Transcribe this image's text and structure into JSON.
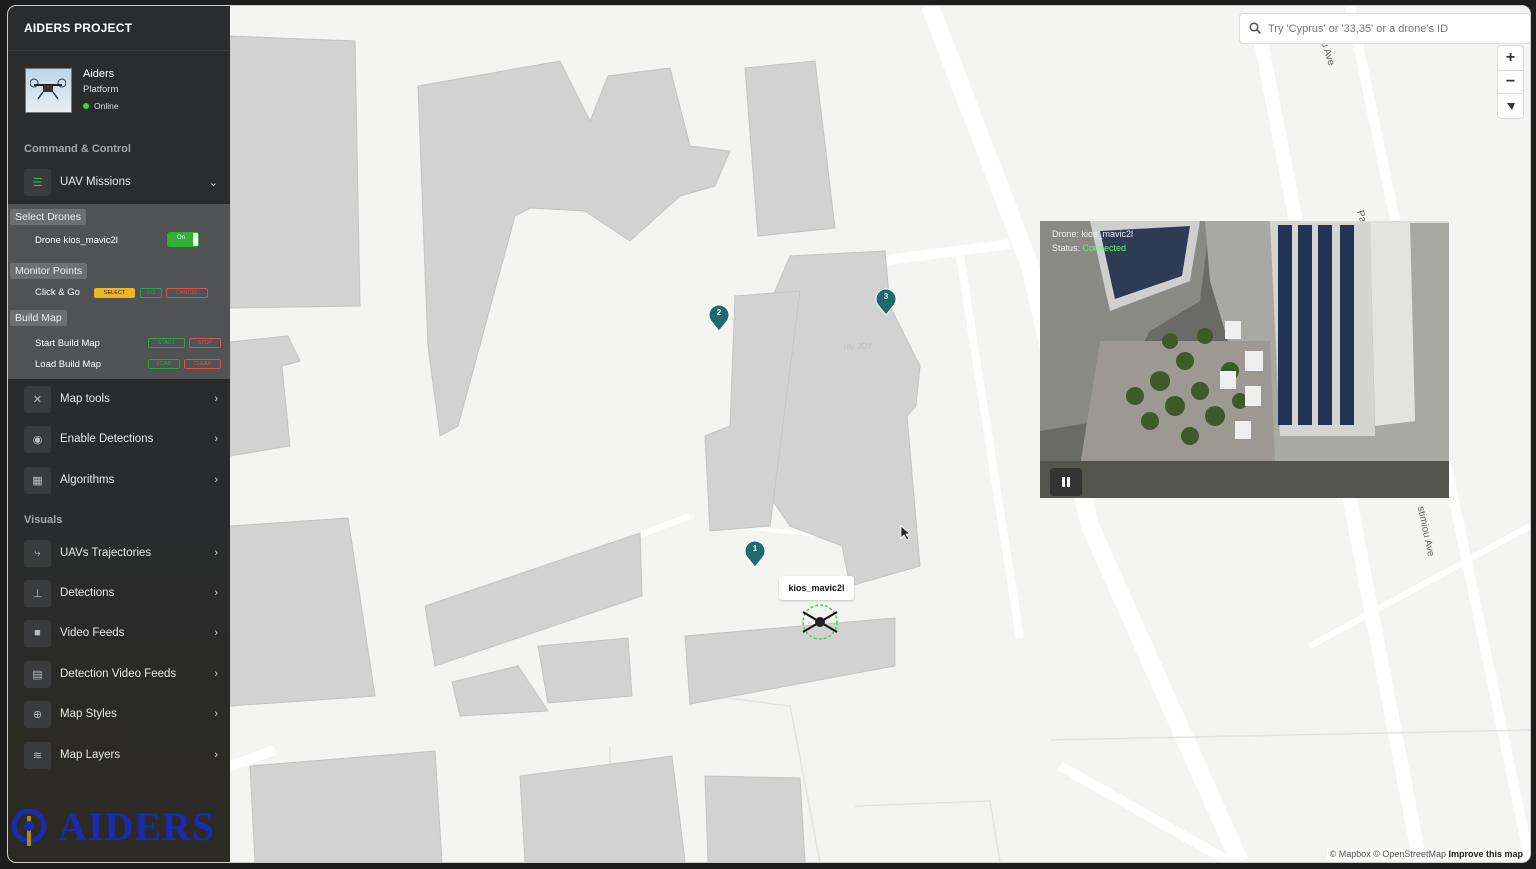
{
  "sidebar": {
    "title": "AIDERS PROJECT",
    "profile": {
      "name": "Aiders",
      "subtitle": "Platform",
      "status": "Online"
    },
    "sections": {
      "command": "Command & Control",
      "visuals": "Visuals"
    },
    "uav_missions": "UAV Missions",
    "submenu": {
      "select_drones": "Select Drones",
      "drone_row": "Drone kios_mavic2l",
      "toggle": "On",
      "monitor_points": "Monitor Points",
      "click_go": "Click & Go",
      "select": "SELECT",
      "go": "GO",
      "cancel": "CANCEL",
      "build_map": "Build Map",
      "start_build": "Start Build Map",
      "start": "START",
      "stop": "STOP",
      "load_build": "Load Build Map",
      "load": "LOAD",
      "clear": "CLEAR"
    },
    "command_items": [
      "Map tools",
      "Enable Detections",
      "Algorithms"
    ],
    "visual_items": [
      "UAVs Trajectories",
      "Detections",
      "Video Feeds",
      "Detection Video Feeds",
      "Map Styles",
      "Map Layers"
    ],
    "logo": "AIDERS"
  },
  "map": {
    "search_placeholder": "Try 'Cyprus' or '33,35' or a drone's ID",
    "zoom_in": "+",
    "zoom_out": "−",
    "drone_label": "kios_mavic2l",
    "markers": [
      "1",
      "2",
      "3"
    ],
    "video": {
      "drone_line": "Drone: kios_mavic2l",
      "status_prefix": "Status: ",
      "status_value": "Connected"
    },
    "place_label": "my JOY",
    "streets": [
      "u Ave",
      "Pa",
      "stimiou Ave"
    ],
    "attribution": {
      "mapbox": "© Mapbox",
      "osm": "© OpenStreetMap",
      "improve": "Improve this map"
    }
  }
}
